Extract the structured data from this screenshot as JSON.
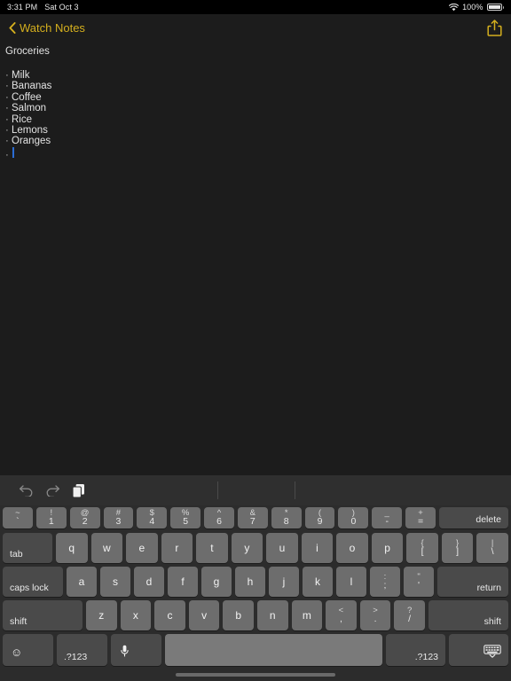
{
  "status_bar": {
    "time": "3:31 PM",
    "date": "Sat Oct 3",
    "wifi_icon": "wifi-icon",
    "battery_percent": "100%",
    "battery_icon": "battery-full-icon"
  },
  "nav_bar": {
    "back_icon": "chevron-left-icon",
    "back_label": "Watch Notes",
    "share_icon": "share-icon",
    "accent_color": "#d4af1e"
  },
  "note": {
    "title": "Groceries",
    "bullet_char": "·",
    "items": [
      "Milk",
      "Bananas",
      "Coffee",
      "Salmon",
      "Rice",
      "Lemons",
      "Oranges",
      ""
    ],
    "caret_color": "#2b6cd4",
    "text_color": "#e3e3e3"
  },
  "keyboard": {
    "toolbar": {
      "undo_icon": "undo-icon",
      "redo_icon": "redo-icon",
      "paste_icon": "paste-icon"
    },
    "row1": [
      {
        "top": "~",
        "bot": "`"
      },
      {
        "top": "!",
        "bot": "1"
      },
      {
        "top": "@",
        "bot": "2"
      },
      {
        "top": "#",
        "bot": "3"
      },
      {
        "top": "$",
        "bot": "4"
      },
      {
        "top": "%",
        "bot": "5"
      },
      {
        "top": "^",
        "bot": "6"
      },
      {
        "top": "&",
        "bot": "7"
      },
      {
        "top": "*",
        "bot": "8"
      },
      {
        "top": "(",
        "bot": "9"
      },
      {
        "top": ")",
        "bot": "0"
      },
      {
        "top": "_",
        "bot": "-"
      },
      {
        "top": "+",
        "bot": "="
      },
      {
        "label": "delete"
      }
    ],
    "row2": [
      {
        "label": "tab"
      },
      {
        "label": "q"
      },
      {
        "label": "w"
      },
      {
        "label": "e"
      },
      {
        "label": "r"
      },
      {
        "label": "t"
      },
      {
        "label": "y"
      },
      {
        "label": "u"
      },
      {
        "label": "i"
      },
      {
        "label": "o"
      },
      {
        "label": "p"
      },
      {
        "top": "{",
        "bot": "["
      },
      {
        "top": "}",
        "bot": "]"
      },
      {
        "top": "|",
        "bot": "\\"
      }
    ],
    "row3": [
      {
        "label": "caps lock"
      },
      {
        "label": "a"
      },
      {
        "label": "s"
      },
      {
        "label": "d"
      },
      {
        "label": "f"
      },
      {
        "label": "g"
      },
      {
        "label": "h"
      },
      {
        "label": "j"
      },
      {
        "label": "k"
      },
      {
        "label": "l"
      },
      {
        "top": ":",
        "bot": ";"
      },
      {
        "top": "\"",
        "bot": "'"
      },
      {
        "label": "return"
      }
    ],
    "row4": [
      {
        "label": "shift"
      },
      {
        "label": "z"
      },
      {
        "label": "x"
      },
      {
        "label": "c"
      },
      {
        "label": "v"
      },
      {
        "label": "b"
      },
      {
        "label": "n"
      },
      {
        "label": "m"
      },
      {
        "top": "<",
        "bot": ","
      },
      {
        "top": ">",
        "bot": "."
      },
      {
        "top": "?",
        "bot": "/"
      },
      {
        "label": "shift"
      }
    ],
    "row5": {
      "emoji_icon": "emoji-icon",
      "numeric_left_label": ".?123",
      "mic_icon": "microphone-icon",
      "space_label": "",
      "numeric_right_label": ".?123",
      "dismiss_icon": "keyboard-dismiss-icon"
    }
  }
}
